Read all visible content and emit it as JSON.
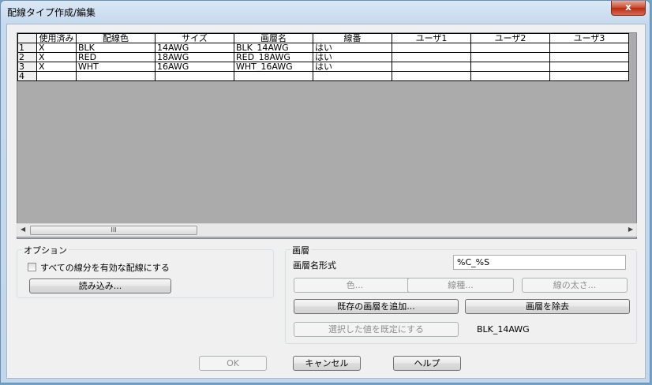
{
  "window": {
    "title": "配線タイプ作成/編集",
    "close_glyph": "x"
  },
  "grid": {
    "columns": [
      "使用済み",
      "配線色",
      "サイズ",
      "画層名",
      "線番",
      "ユーザ1",
      "ユーザ2",
      "ユーザ3"
    ],
    "rows": [
      {
        "num": "1",
        "cells": [
          "X",
          "BLK",
          "14AWG",
          "BLK_14AWG",
          "はい",
          "",
          "",
          ""
        ]
      },
      {
        "num": "2",
        "cells": [
          "X",
          "RED",
          "18AWG",
          "RED_18AWG",
          "はい",
          "",
          "",
          ""
        ]
      },
      {
        "num": "3",
        "cells": [
          "X",
          "WHT",
          "16AWG",
          "WHT_16AWG",
          "はい",
          "",
          "",
          ""
        ]
      },
      {
        "num": "4",
        "cells": [
          "",
          "",
          "",
          "",
          "",
          "",
          "",
          ""
        ]
      }
    ],
    "scroll_grip": "III"
  },
  "options": {
    "label": "オプション",
    "checkbox_label": "すべての線分を有効な配線にする",
    "checkbox_checked": false,
    "load_button": "読み込み..."
  },
  "layer": {
    "label": "画層",
    "name_format_label": "画層名形式",
    "name_format_value": "%C_%S",
    "color_button": "色...",
    "linetype_button": "線種...",
    "lineweight_button": "線の太さ...",
    "add_existing_button": "既存の画層を追加...",
    "remove_button": "画層を除去",
    "set_default_button": "選択した値を既定にする",
    "current_value": "BLK_14AWG"
  },
  "footer": {
    "ok": "OK",
    "cancel": "キャンセル",
    "help": "ヘルプ"
  }
}
